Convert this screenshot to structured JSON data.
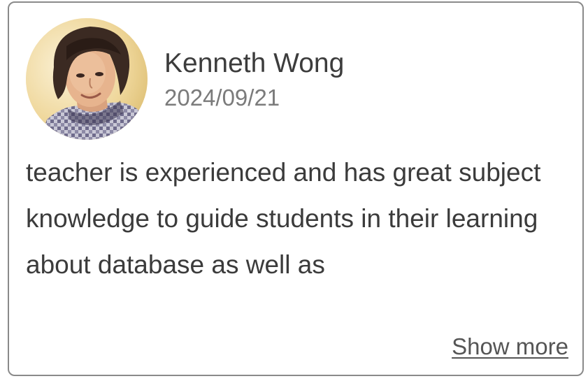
{
  "review": {
    "author_name": "Kenneth Wong",
    "date": "2024/09/21",
    "text": "teacher is experienced and has great subject knowledge to guide students in their learning about database as well as",
    "show_more_label": "Show more"
  },
  "avatar": {
    "icon": "user-photo",
    "alt": ""
  },
  "colors": {
    "card_border": "#8a8a8a",
    "name_text": "#3c3c3c",
    "date_text": "#7b7b7b",
    "body_text": "#3b3b3b",
    "link_text": "#555555"
  }
}
